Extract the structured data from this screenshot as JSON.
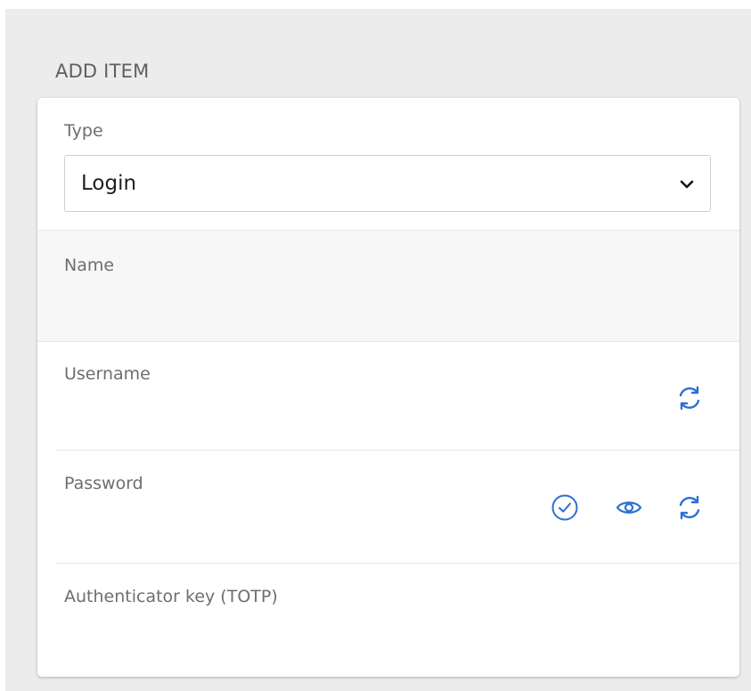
{
  "section": {
    "title": "ADD ITEM"
  },
  "form": {
    "type_label": "Type",
    "type_value": "Login",
    "name_label": "Name",
    "username_label": "Username",
    "password_label": "Password",
    "totp_label": "Authenticator key (TOTP)"
  },
  "icons": {
    "username_generate": "refresh-icon",
    "password_check": "check-circle-icon",
    "password_toggle": "eye-icon",
    "password_generate": "refresh-icon",
    "select_chevron": "chevron-down-icon"
  },
  "colors": {
    "accent": "#2c6fd6",
    "page_background": "#ececec",
    "card_background": "#ffffff"
  }
}
